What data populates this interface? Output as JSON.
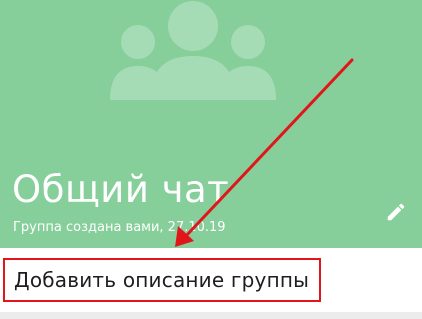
{
  "header": {
    "background": "#86cf9b",
    "avatar_icon": "group-placeholder-icon",
    "title": "Общий чат",
    "subtitle": "Группа создана вами, 27.10.19",
    "edit_icon": "pencil-icon"
  },
  "description": {
    "label": "Добавить описание группы",
    "highlight_color": "#e0161b"
  },
  "annotation": {
    "arrow_color": "#e0161b"
  }
}
